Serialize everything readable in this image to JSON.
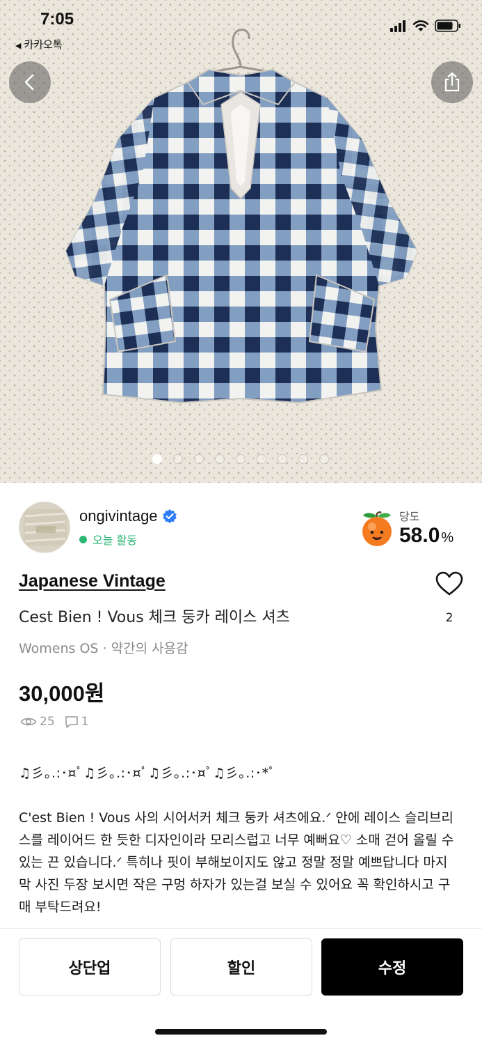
{
  "status_bar": {
    "time": "7:05",
    "back_app_label": "카카오톡",
    "icons": [
      "signal-icon",
      "wifi-icon",
      "battery-icon"
    ]
  },
  "nav": {
    "back_icon": "chevron-left-icon",
    "share_icon": "share-icon"
  },
  "carousel": {
    "total": 9,
    "active_index": 0
  },
  "seller": {
    "name": "ongivintage",
    "verified_icon": "verified-badge-icon",
    "activity": "오늘 활동",
    "activity_color": "#2bb673"
  },
  "sweetness": {
    "label": "당도",
    "value": "58.0",
    "unit": "%",
    "icon": "peach-icon"
  },
  "item": {
    "brand": "Japanese Vintage",
    "title": "Cest Bien ! Vous 체크 둥카 레이스 셔츠",
    "meta": "Womens OS · 약간의 사용감",
    "price": "30,000원",
    "views": "25",
    "comments": "1",
    "likes": "2"
  },
  "description": {
    "decoration": "♫彡｡.:･¤ﾟ♫彡｡.:･¤ﾟ♫彡｡.:･¤ﾟ♫彡｡.:･*ﾟ",
    "body": "C'est Bien ! Vous 사의 시어서커 체크 둥카 셔츠에요.ᐟ 안에 레이스 슬리브리스를 레이어드 한 듯한 디자인이라 모리스럽고 너무 예뻐요♡ 소매 걷어 올릴 수 있는 끈 있습니다.ᐟ 특히나 핏이 부해보이지도 않고 정말 정말 예쁘답니다 마지막 사진 두장 보시면 작은 구멍 하자가 있는걸 보실 수 있어요 꼭 확인하시고 구매 부탁드려요!"
  },
  "actions": {
    "bump": "상단업",
    "discount": "할인",
    "edit": "수정"
  }
}
